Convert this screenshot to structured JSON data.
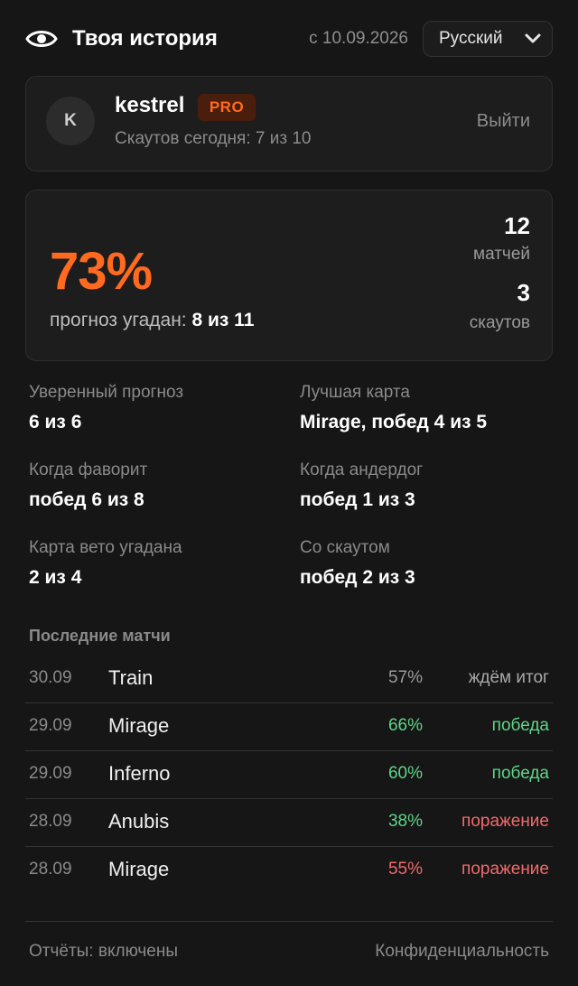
{
  "header": {
    "title": "Твоя история",
    "since": "с 10.09.2026",
    "language": "Русский",
    "icon": "eye-icon"
  },
  "user": {
    "avatar_letter": "K",
    "name": "kestrel",
    "badge": "PRO",
    "quota": "Скаутов сегодня: 7 из 10",
    "logout": "Выйти"
  },
  "summary": {
    "accuracy": "73%",
    "guess_label": "прогноз угадан:",
    "guess_value": "8 из 11",
    "matches_count": "12",
    "matches_label": "матчей",
    "scouts_count": "3",
    "scouts_label": "скаутов"
  },
  "metrics": [
    {
      "label": "Уверенный прогноз",
      "value": "6 из 6"
    },
    {
      "label": "Лучшая карта",
      "value": "Mirage, побед 4 из 5"
    },
    {
      "label": "Когда фаворит",
      "value": "побед 6 из 8"
    },
    {
      "label": "Когда андердог",
      "value": "побед 1 из 3"
    },
    {
      "label": "Карта вето угадана",
      "value": "2 из 4"
    },
    {
      "label": "Со скаутом",
      "value": "побед 2 из 3"
    }
  ],
  "recent": {
    "title": "Последние матчи",
    "rows": [
      {
        "date": "30.09",
        "map": "Train",
        "pct": "57%",
        "pct_color": "#9a9a9a",
        "result": "ждём итог",
        "result_color": "#a8a8a8"
      },
      {
        "date": "29.09",
        "map": "Mirage",
        "pct": "66%",
        "pct_color": "#5fd486",
        "result": "победа",
        "result_color": "#5fd486"
      },
      {
        "date": "29.09",
        "map": "Inferno",
        "pct": "60%",
        "pct_color": "#5fd486",
        "result": "победа",
        "result_color": "#5fd486"
      },
      {
        "date": "28.09",
        "map": "Anubis",
        "pct": "38%",
        "pct_color": "#5fd486",
        "result": "поражение",
        "result_color": "#f26a6a"
      },
      {
        "date": "28.09",
        "map": "Mirage",
        "pct": "55%",
        "pct_color": "#f26a6a",
        "result": "поражение",
        "result_color": "#f26a6a"
      }
    ]
  },
  "footer": {
    "reports": "Отчёты: включены",
    "privacy": "Конфиденциальность"
  },
  "colors": {
    "accent": "#ff6a1f",
    "win": "#5fd486",
    "loss": "#f26a6a",
    "background": "#161616"
  }
}
